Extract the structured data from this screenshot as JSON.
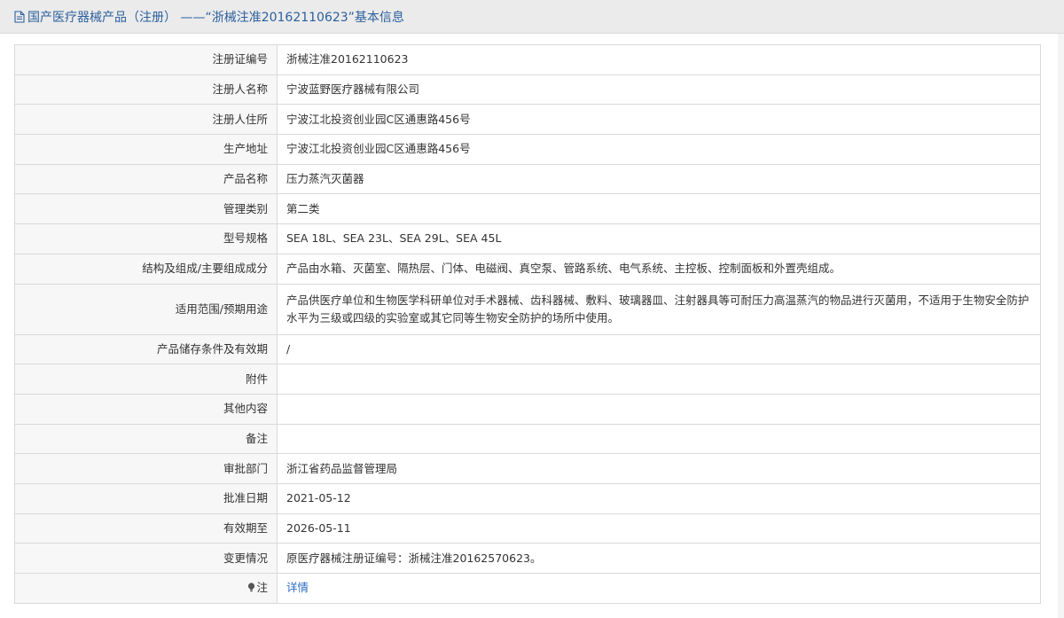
{
  "header": {
    "icon": "document-icon",
    "title": "国产医疗器械产品（注册） ——“浙械注准20162110623”基本信息"
  },
  "colors": {
    "title_blue": "#2b5f9e",
    "link_blue": "#2b6cc4",
    "label_bg": "#f7f7f7",
    "border": "#d9d9d9",
    "header_bg": "#ebebeb"
  },
  "rows": [
    {
      "label": "注册证编号",
      "value": "浙械注准20162110623"
    },
    {
      "label": "注册人名称",
      "value": "宁波蓝野医疗器械有限公司"
    },
    {
      "label": "注册人住所",
      "value": "宁波江北投资创业园C区通惠路456号"
    },
    {
      "label": "生产地址",
      "value": "宁波江北投资创业园C区通惠路456号"
    },
    {
      "label": "产品名称",
      "value": "压力蒸汽灭菌器"
    },
    {
      "label": "管理类别",
      "value": "第二类"
    },
    {
      "label": "型号规格",
      "value": "SEA 18L、SEA 23L、SEA 29L、SEA 45L"
    },
    {
      "label": "结构及组成/主要组成成分",
      "value": "产品由水箱、灭菌室、隔热层、门体、电磁阀、真空泵、管路系统、电气系统、主控板、控制面板和外置壳组成。"
    },
    {
      "label": "适用范围/预期用途",
      "value": "产品供医疗单位和生物医学科研单位对手术器械、齿科器械、敷料、玻璃器皿、注射器具等可耐压力高温蒸汽的物品进行灭菌用，不适用于生物安全防护水平为三级或四级的实验室或其它同等生物安全防护的场所中使用。"
    },
    {
      "label": "产品储存条件及有效期",
      "value": "/"
    },
    {
      "label": "附件",
      "value": ""
    },
    {
      "label": "其他内容",
      "value": ""
    },
    {
      "label": "备注",
      "value": ""
    },
    {
      "label": "审批部门",
      "value": "浙江省药品监督管理局"
    },
    {
      "label": "批准日期",
      "value": "2021-05-12"
    },
    {
      "label": "有效期至",
      "value": "2026-05-11"
    },
    {
      "label": "变更情况",
      "value": "原医疗器械注册证编号：浙械注准20162570623。"
    }
  ],
  "note": {
    "icon": "lightbulb-icon",
    "label": "注",
    "link_text": "详情"
  }
}
